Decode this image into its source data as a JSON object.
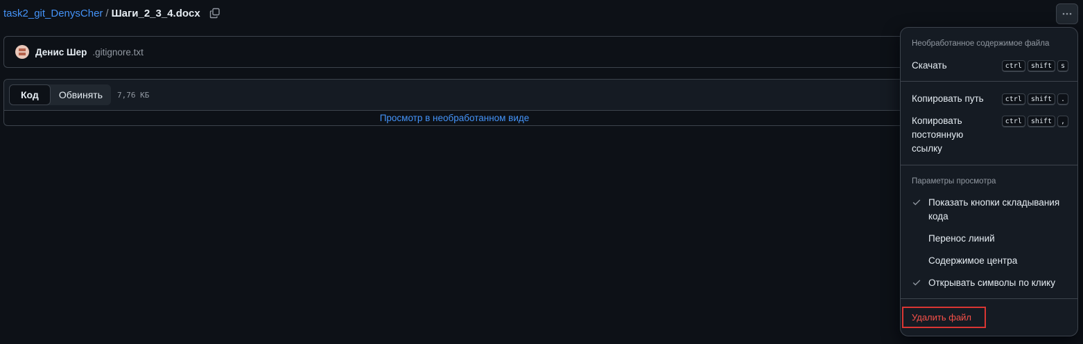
{
  "breadcrumb": {
    "repo": "task2_git_DenysCher",
    "separator": "/",
    "file": "Шаги_2_3_4.docx"
  },
  "commit": {
    "author": "Денис Шер",
    "message": ".gitignore.txt"
  },
  "file_view": {
    "tab_code": "Код",
    "tab_blame": "Обвинять",
    "size": "7,76 КБ",
    "raw_link": "Просмотр в необработанном виде"
  },
  "menu": {
    "raw_title": "Необработанное содержимое файла",
    "download": {
      "label": "Скачать",
      "keys": [
        "ctrl",
        "shift",
        "s"
      ]
    },
    "copy_path": {
      "label": "Копировать путь",
      "keys": [
        "ctrl",
        "shift",
        "."
      ]
    },
    "copy_permalink": {
      "label": "Копировать постоянную ссылку",
      "keys": [
        "ctrl",
        "shift",
        ","
      ]
    },
    "view_title": "Параметры просмотра",
    "options": [
      {
        "label": "Показать кнопки складывания кода",
        "checked": true
      },
      {
        "label": "Перенос линий",
        "checked": false
      },
      {
        "label": "Содержимое центра",
        "checked": false
      },
      {
        "label": "Открывать символы по клику",
        "checked": true
      }
    ],
    "delete": "Удалить файл"
  },
  "icons": {
    "copy": "copy-icon",
    "more": "kebab-horizontal-icon",
    "check": "check-icon"
  },
  "colors": {
    "background": "#0d1117",
    "link": "#4493f8",
    "danger": "#f85149",
    "muted": "#9198a1"
  }
}
